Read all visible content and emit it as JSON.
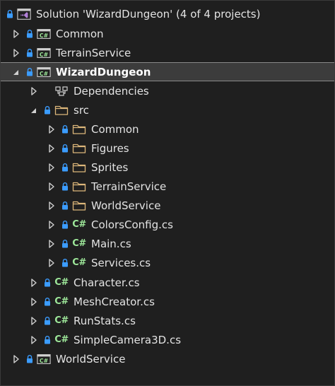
{
  "solution": {
    "label": "Solution 'WizardDungeon' (4 of 4 projects)"
  },
  "projects": {
    "common": "Common",
    "terrain_service": "TerrainService",
    "wizard_dungeon": "WizardDungeon",
    "world_service": "WorldService"
  },
  "wizard": {
    "dependencies": "Dependencies",
    "src": "src",
    "src_items": {
      "common": "Common",
      "figures": "Figures",
      "sprites": "Sprites",
      "terrain_service": "TerrainService",
      "world_service": "WorldService",
      "colors_config": "ColorsConfig.cs",
      "main": "Main.cs",
      "services": "Services.cs"
    },
    "files": {
      "character": "Character.cs",
      "mesh_creator": "MeshCreator.cs",
      "run_stats": "RunStats.cs",
      "simple_camera": "SimpleCamera3D.cs"
    }
  },
  "icon_labels": {
    "csharp_file": "C#",
    "csproj": "C#"
  },
  "colors": {
    "background": "#1f1f1f",
    "selection": "#3c3c3c",
    "lock_blue": "#3b9cff",
    "folder": "#dcb67a",
    "csharp_green": "#9ee89a",
    "text": "#e3e3e3"
  }
}
